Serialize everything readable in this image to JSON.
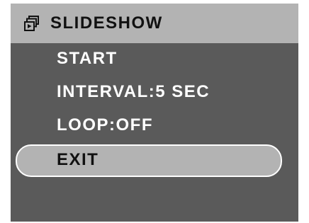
{
  "header": {
    "title": "SLIDESHOW",
    "icon": "slideshow-icon"
  },
  "menu": {
    "items": [
      {
        "label": "START"
      },
      {
        "label": "INTERVAL:5 SEC"
      },
      {
        "label": "LOOP:OFF"
      },
      {
        "label": "EXIT"
      }
    ],
    "selected_index": 3
  },
  "colors": {
    "screen_background": "#5a5a5a",
    "header_background": "#b3b3b3",
    "highlight_background": "#b3b3b3",
    "highlight_border": "#ffffff",
    "text_light": "#ffffff",
    "text_dark": "#111111"
  }
}
